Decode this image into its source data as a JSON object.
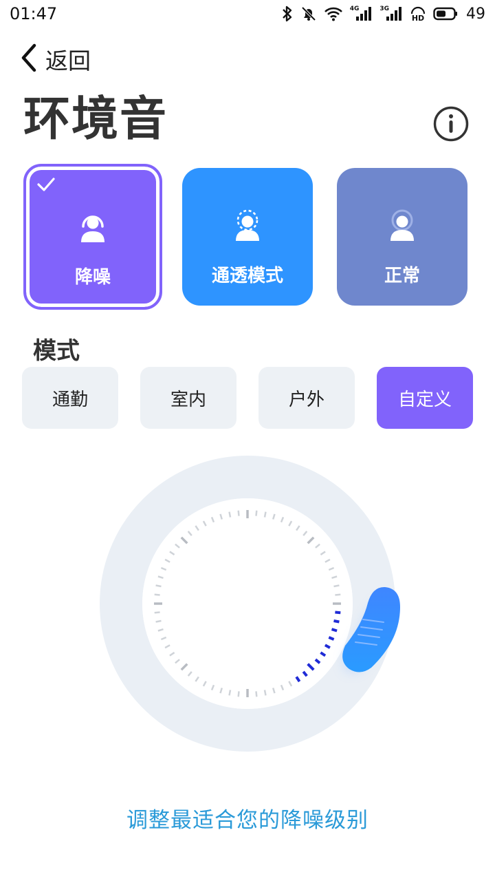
{
  "status_bar": {
    "time": "01:47",
    "battery": "49",
    "icons": [
      "bluetooth-icon",
      "mute-bell-icon",
      "wifi-icon",
      "signal-4g-icon",
      "signal-3g-icon",
      "hd-icon",
      "battery-icon"
    ],
    "tags": {
      "4g": "4G",
      "3g": "3G"
    }
  },
  "header": {
    "back_label": "返回",
    "title": "环境音",
    "info_icon": "info-icon"
  },
  "modes": [
    {
      "label": "降噪",
      "selected": true,
      "color": "#8163fb",
      "icon": "noise-cancel-person-icon"
    },
    {
      "label": "通透模式",
      "selected": false,
      "color": "#2e94ff",
      "icon": "transparency-person-icon"
    },
    {
      "label": "正常",
      "selected": false,
      "color": "#6f87cd",
      "icon": "normal-person-icon"
    }
  ],
  "section": {
    "title": "模式"
  },
  "scenes": [
    {
      "label": "通勤",
      "active": false
    },
    {
      "label": "室内",
      "active": false
    },
    {
      "label": "户外",
      "active": false
    },
    {
      "label": "自定义",
      "active": true
    }
  ],
  "dial": {
    "level_fraction": 0.28,
    "accent_color": "#1f2bd6",
    "knob_color": "#2f7cff"
  },
  "hint": "调整最适合您的降噪级别"
}
